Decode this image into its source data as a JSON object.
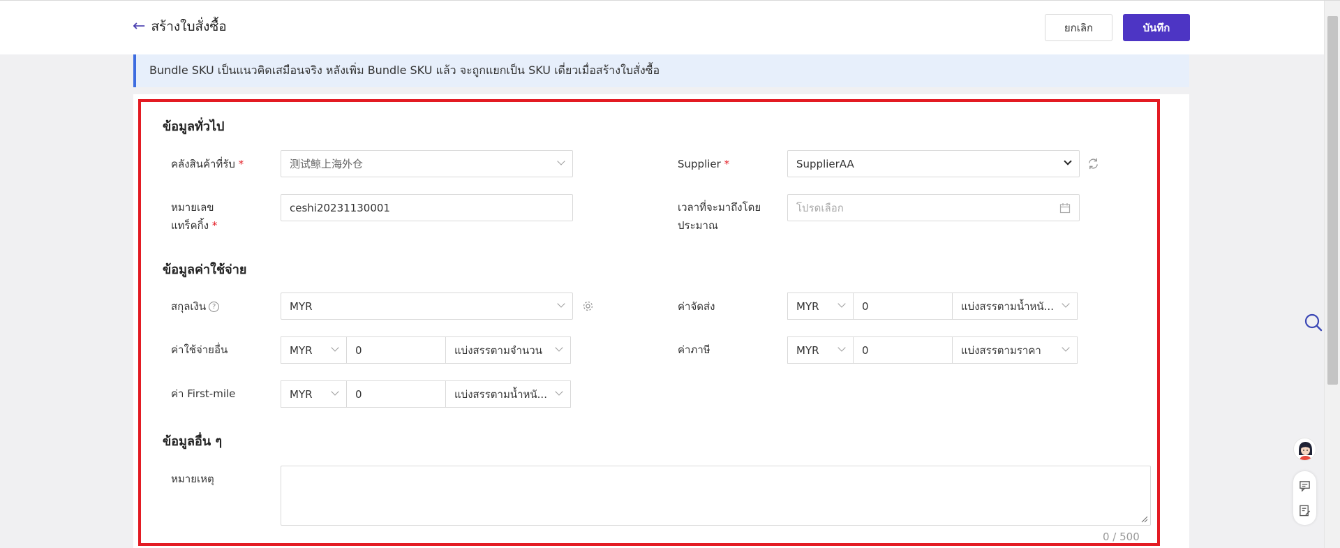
{
  "header": {
    "title": "สร้างใบสั่งซื้อ",
    "cancel_label": "ยกเลิก",
    "save_label": "บันทึก"
  },
  "notice": "Bundle SKU เป็นแนวคิดเสมือนจริง หลังเพิ่ม Bundle SKU แล้ว จะถูกแยกเป็น SKU เดี่ยวเมื่อสร้างใบสั่งซื้อ",
  "general": {
    "section_title": "ข้อมูลทั่วไป",
    "warehouse_label": "คลังสินค้าที่รับ",
    "warehouse_value": "测试鲸上海外仓",
    "supplier_label": "Supplier",
    "supplier_value": "SupplierAA",
    "tracking_label_line1": "หมายเลข",
    "tracking_label_line2": "แทร็คกิ้ง",
    "tracking_value": "ceshi20231130001",
    "eta_label_line1": "เวลาที่จะมาถึงโดย",
    "eta_label_line2": "ประมาณ",
    "eta_placeholder": "โปรดเลือก"
  },
  "cost": {
    "section_title": "ข้อมูลค่าใช้จ่าย",
    "currency_label": "สกุลเงิน",
    "currency_value": "MYR",
    "shipping_label": "ค่าจัดส่ง",
    "shipping_currency": "MYR",
    "shipping_amount": "0",
    "shipping_alloc": "แบ่งสรรตามน้ำหนั...",
    "other_label": "ค่าใช้จ่ายอื่น",
    "other_currency": "MYR",
    "other_amount": "0",
    "other_alloc": "แบ่งสรรตามจำนวน",
    "tax_label": "ค่าภาษี",
    "tax_currency": "MYR",
    "tax_amount": "0",
    "tax_alloc": "แบ่งสรรตามราคา",
    "firstmile_label": "ค่า First-mile",
    "firstmile_currency": "MYR",
    "firstmile_amount": "0",
    "firstmile_alloc": "แบ่งสรรตามน้ำหนั..."
  },
  "other": {
    "section_title": "ข้อมูลอื่น ๆ",
    "remark_label": "หมายเหตุ",
    "counter": "0 / 500"
  },
  "colors": {
    "primary": "#4d35c4",
    "highlight_border": "#e31b23",
    "notice_bg": "#e7effb"
  }
}
